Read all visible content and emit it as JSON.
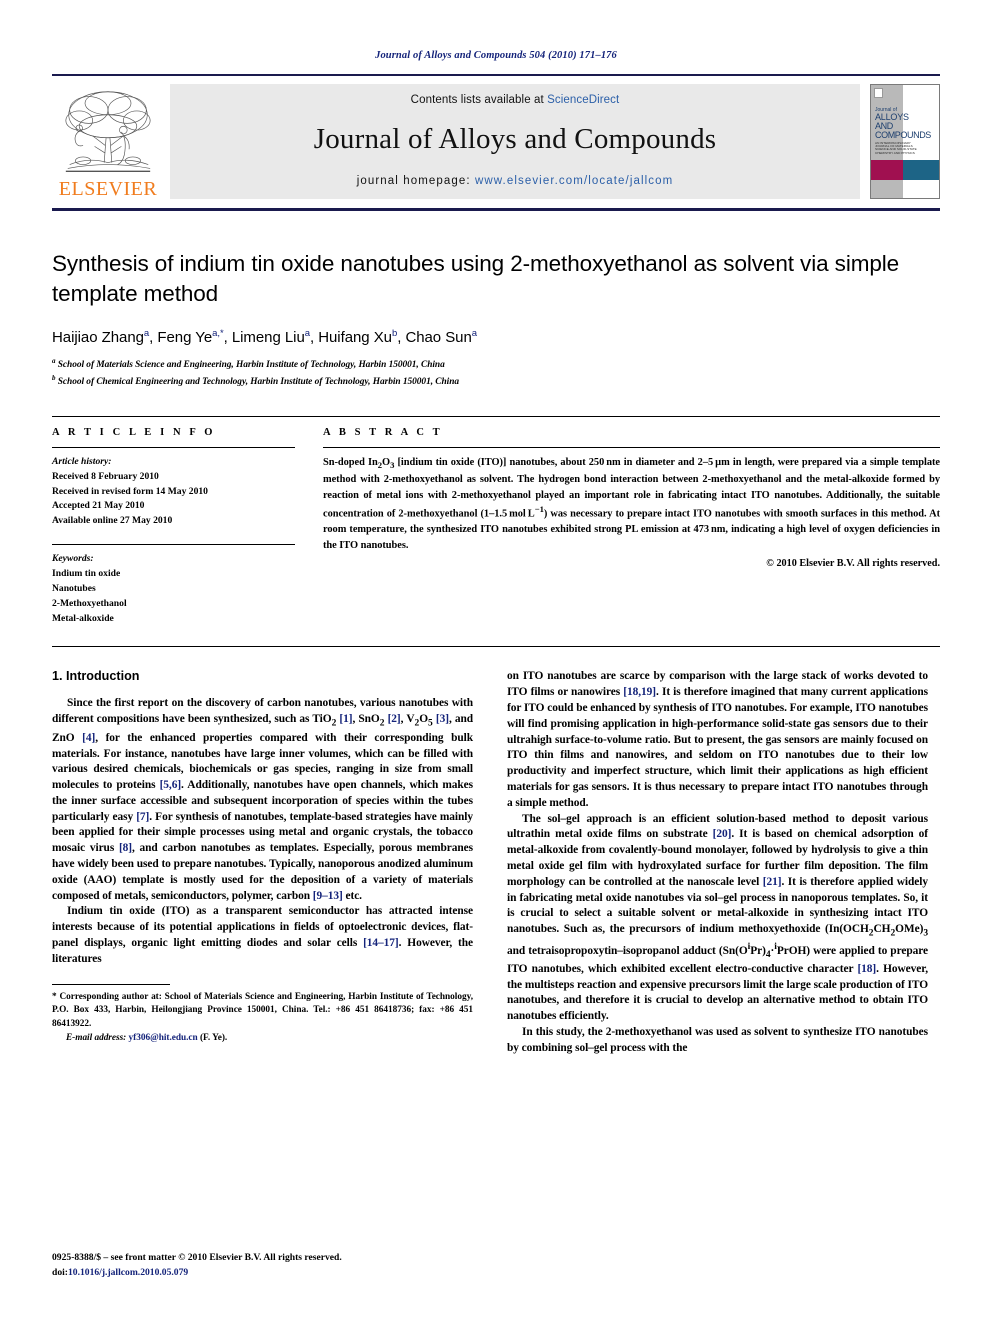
{
  "running_head": "Journal of Alloys and Compounds 504 (2010) 171–176",
  "masthead": {
    "contents_prefix": "Contents lists available at ",
    "sciencedirect": "ScienceDirect",
    "journal_title": "Journal of Alloys and Compounds",
    "homepage_label": "journal homepage: ",
    "homepage_url": "www.elsevier.com/locate/jallcom",
    "publisher_wordmark": "ELSEVIER",
    "cover": {
      "line1": "Journal of",
      "line2": "ALLOYS",
      "line3": "AND COMPOUNDS",
      "line4": "AN INTERDISCIPLINARY JOURNAL OF MATERIALS SCIENCE AND SOLID-STATE CHEMISTRY AND PHYSICS"
    },
    "colors": {
      "rule": "#1a1a4e",
      "band": "#e9e9e9",
      "link": "#2b5fa8",
      "elsevier_orange": "#f07c1e",
      "cover_magenta": "#a01050",
      "cover_teal": "#1d6486",
      "cover_gray": "#b9b9b9"
    }
  },
  "article": {
    "title": "Synthesis of indium tin oxide nanotubes using 2-methoxyethanol as solvent via simple template method",
    "authors": [
      {
        "name": "Haijiao Zhang",
        "sup": "a"
      },
      {
        "name": "Feng Ye",
        "sup": "a,*"
      },
      {
        "name": "Limeng Liu",
        "sup": "a"
      },
      {
        "name": "Huifang Xu",
        "sup": "b"
      },
      {
        "name": "Chao Sun",
        "sup": "a"
      }
    ],
    "affiliations": [
      {
        "sup": "a",
        "text": "School of Materials Science and Engineering, Harbin Institute of Technology, Harbin 150001, China"
      },
      {
        "sup": "b",
        "text": "School of Chemical Engineering and Technology, Harbin Institute of Technology, Harbin 150001, China"
      }
    ]
  },
  "article_info": {
    "heading": "A R T I C L E   I N F O",
    "history_label": "Article history:",
    "history": [
      "Received 8 February 2010",
      "Received in revised form 14 May 2010",
      "Accepted 21 May 2010",
      "Available online 27 May 2010"
    ],
    "keywords_label": "Keywords:",
    "keywords": [
      "Indium tin oxide",
      "Nanotubes",
      "2-Methoxyethanol",
      "Metal-alkoxide"
    ]
  },
  "abstract": {
    "heading": "A B S T R A C T",
    "copyright": "© 2010 Elsevier B.V. All rights reserved."
  },
  "introduction": {
    "heading": "1.  Introduction"
  },
  "footnote": {
    "corresponding": "* Corresponding author at: School of Materials Science and Engineering, Harbin Institute of Technology, P.O. Box 433, Harbin, Heilongjiang Province 150001, China. Tel.: +86 451 86418736; fax: +86 451 86413922.",
    "email_label": "E-mail address:",
    "email": "yf306@hit.edu.cn",
    "email_suffix": "(F. Ye)."
  },
  "page_footer": {
    "front_matter": "0925-8388/$ – see front matter © 2010 Elsevier B.V. All rights reserved.",
    "doi_label": "doi:",
    "doi": "10.1016/j.jallcom.2010.05.079"
  }
}
